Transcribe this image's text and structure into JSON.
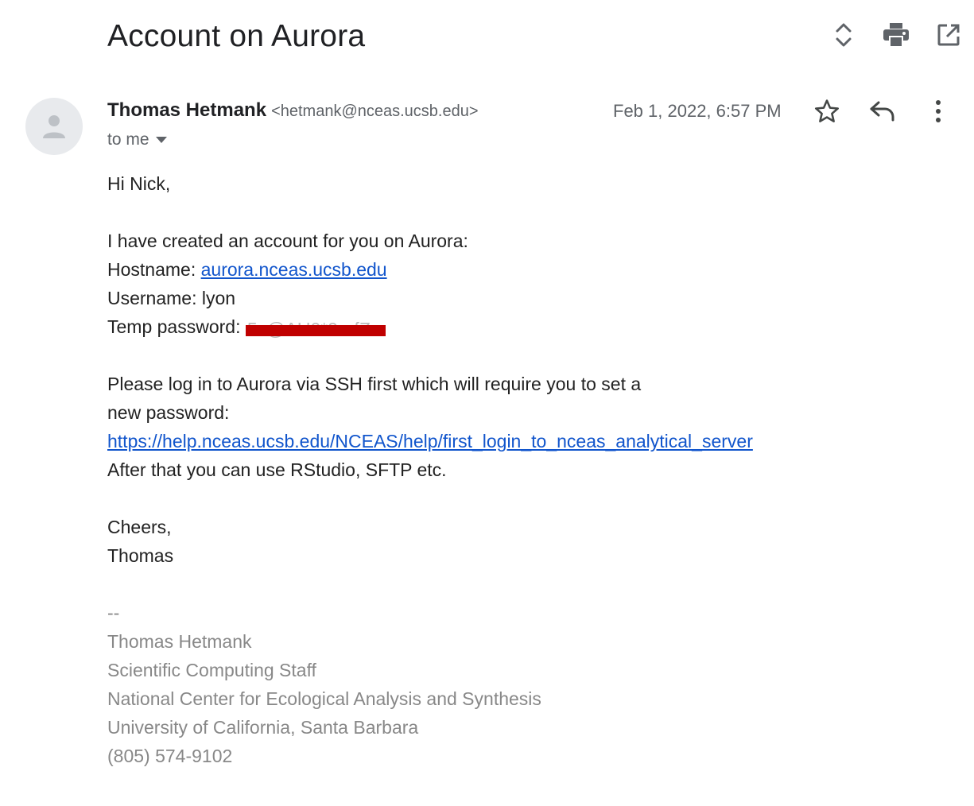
{
  "subject": "Account on Aurora",
  "top_actions": {
    "icons": [
      "expand-collapse-icon",
      "print-icon",
      "open-in-new-window-icon"
    ]
  },
  "sender": {
    "name": "Thomas Hetmank",
    "email": "<hetmank@nceas.ucsb.edu>"
  },
  "date": "Feb 1, 2022, 6:57 PM",
  "recipient_label": "to me",
  "header_actions": {
    "icons": [
      "star-icon",
      "reply-icon",
      "more-vert-icon"
    ]
  },
  "body": {
    "greeting": "Hi Nick,",
    "line1": "I have created an account for you on Aurora:",
    "hostname_label": "Hostname: ",
    "hostname_link": "aurora.nceas.ucsb.edu",
    "username": "Username: lyon",
    "password_label": "Temp password: ",
    "password_redacted": "5v@AU0*9a-fZ",
    "instr1": "Please log in to Aurora via SSH first which will require you to set a",
    "instr2": "new password:",
    "help_link": "https://help.nceas.ucsb.edu/NCEAS/help/first_login_to_nceas_analytical_server",
    "after": "After that you can use RStudio, SFTP etc.",
    "closing": "Cheers,",
    "closing_name": "Thomas"
  },
  "signature": {
    "separator": "--",
    "name": "Thomas Hetmank",
    "title": "Scientific Computing Staff",
    "org": "National Center for Ecological Analysis and Synthesis",
    "university": "University of California, Santa Barbara",
    "phone": "(805) 574-9102"
  },
  "colors": {
    "link": "#1155cc",
    "redaction": "#c00000",
    "signature": "#888888"
  }
}
